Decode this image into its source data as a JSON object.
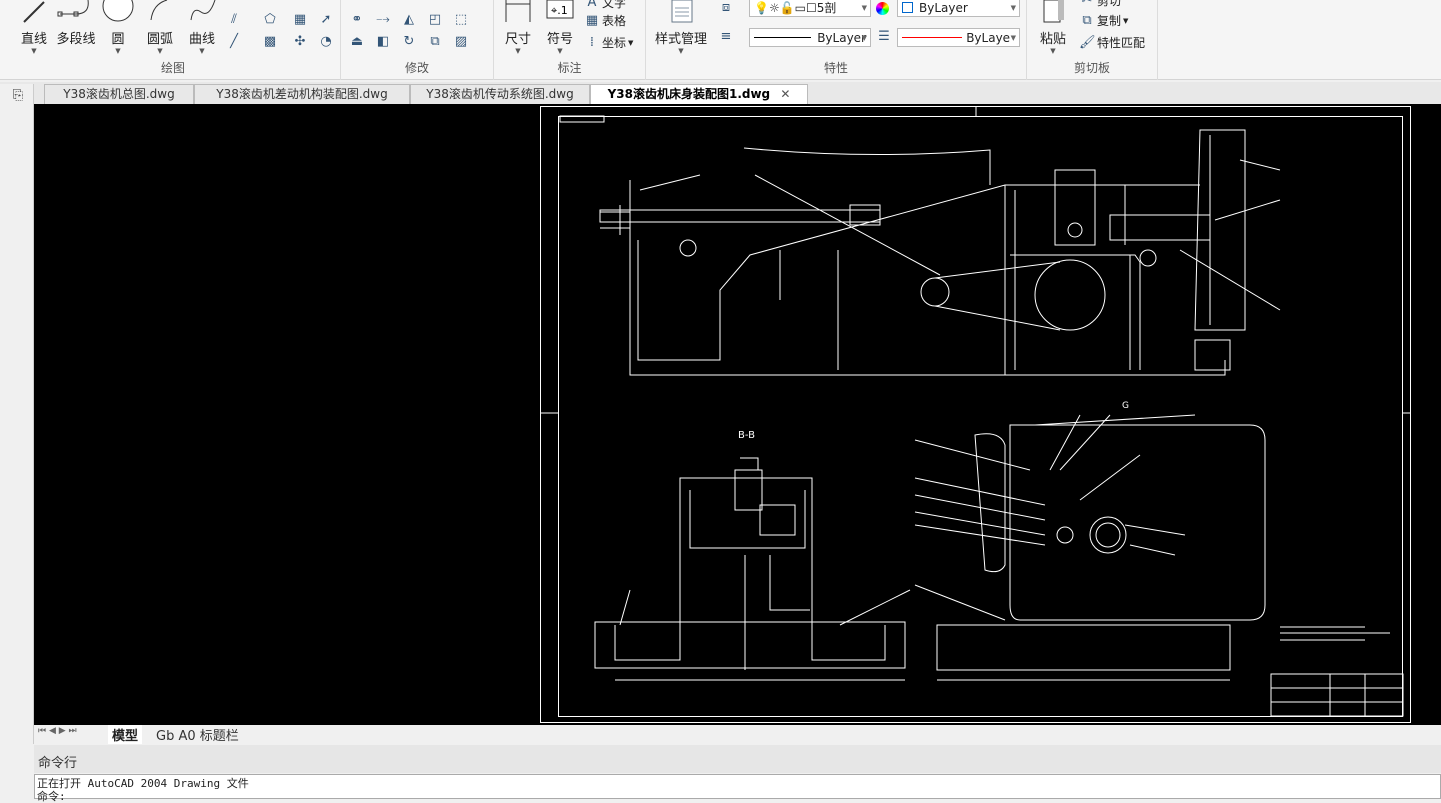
{
  "ribbon": {
    "draw": {
      "title": "绘图",
      "line": "直线",
      "polyline": "多段线",
      "circle": "圆",
      "arc": "圆弧",
      "curve": "曲线"
    },
    "modify": {
      "title": "修改"
    },
    "annotate": {
      "title": "标注",
      "dimension": "尺寸",
      "symbol": "符号",
      "text": "文字",
      "table": "表格",
      "coordinate": "坐标"
    },
    "properties": {
      "title": "特性",
      "style_manager": "样式管理",
      "layer_value": "5剖",
      "color_value": "ByLayer",
      "linetype_value": "ByLayer",
      "lineweight_value": "ByLayer"
    },
    "clipboard": {
      "title": "剪切板",
      "paste": "粘贴",
      "cut": "剪切",
      "copy": "复制",
      "match_properties": "特性匹配"
    }
  },
  "doc_tabs": [
    {
      "label": "Y38滚齿机总图.dwg"
    },
    {
      "label": "Y38滚齿机差动机构装配图.dwg"
    },
    {
      "label": "Y38滚齿机传动系统图.dwg"
    },
    {
      "label": "Y38滚齿机床身装配图1.dwg",
      "active": true
    }
  ],
  "drawing": {
    "section_label": "B-B",
    "view_label": "G"
  },
  "layout_tabs": [
    {
      "label": "模型",
      "active": true
    },
    {
      "label": "Gb A0 标题栏"
    }
  ],
  "command": {
    "header": "命令行",
    "lines": [
      "正在打开 AutoCAD 2004 Drawing 文件",
      "命令:"
    ]
  },
  "colors": {
    "canvas": "#000000",
    "drawing_lines": "#ffffff",
    "lineweight_red": "#ff0000"
  }
}
